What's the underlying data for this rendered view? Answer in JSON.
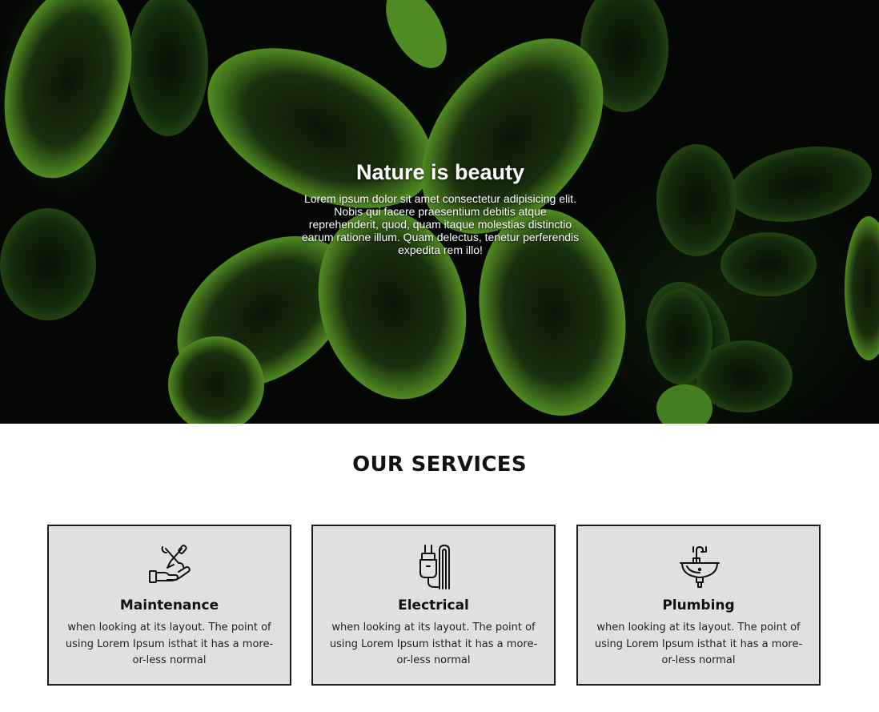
{
  "hero": {
    "title": "Nature is beauty",
    "text": "Lorem ipsum dolor sit amet consectetur adipisicing elit. Nobis qui facere praesentium debitis atque reprehenderit, quod, quam itaque molestias distinctio earum ratione illum. Quam delectus, tenetur perferendis expedita rem illo!"
  },
  "services": {
    "title": "OUR SERVICES",
    "items": [
      {
        "icon": "maintenance-tools-hand-icon",
        "title": "Maintenance",
        "text": "when looking at its layout. The point of using Lorem Ipsum isthat it has a more-or-less normal"
      },
      {
        "icon": "electrical-plug-icon",
        "title": "Electrical",
        "text": "when looking at its layout. The point of using Lorem Ipsum isthat it has a more-or-less normal"
      },
      {
        "icon": "plumbing-sink-icon",
        "title": "Plumbing",
        "text": "when looking at its layout. The point of using Lorem Ipsum isthat it has a more-or-less normal"
      }
    ]
  },
  "colors": {
    "card_background": "#e0e0e0",
    "card_border": "#1c1c1c",
    "leaf_green": "#5aa02c"
  }
}
